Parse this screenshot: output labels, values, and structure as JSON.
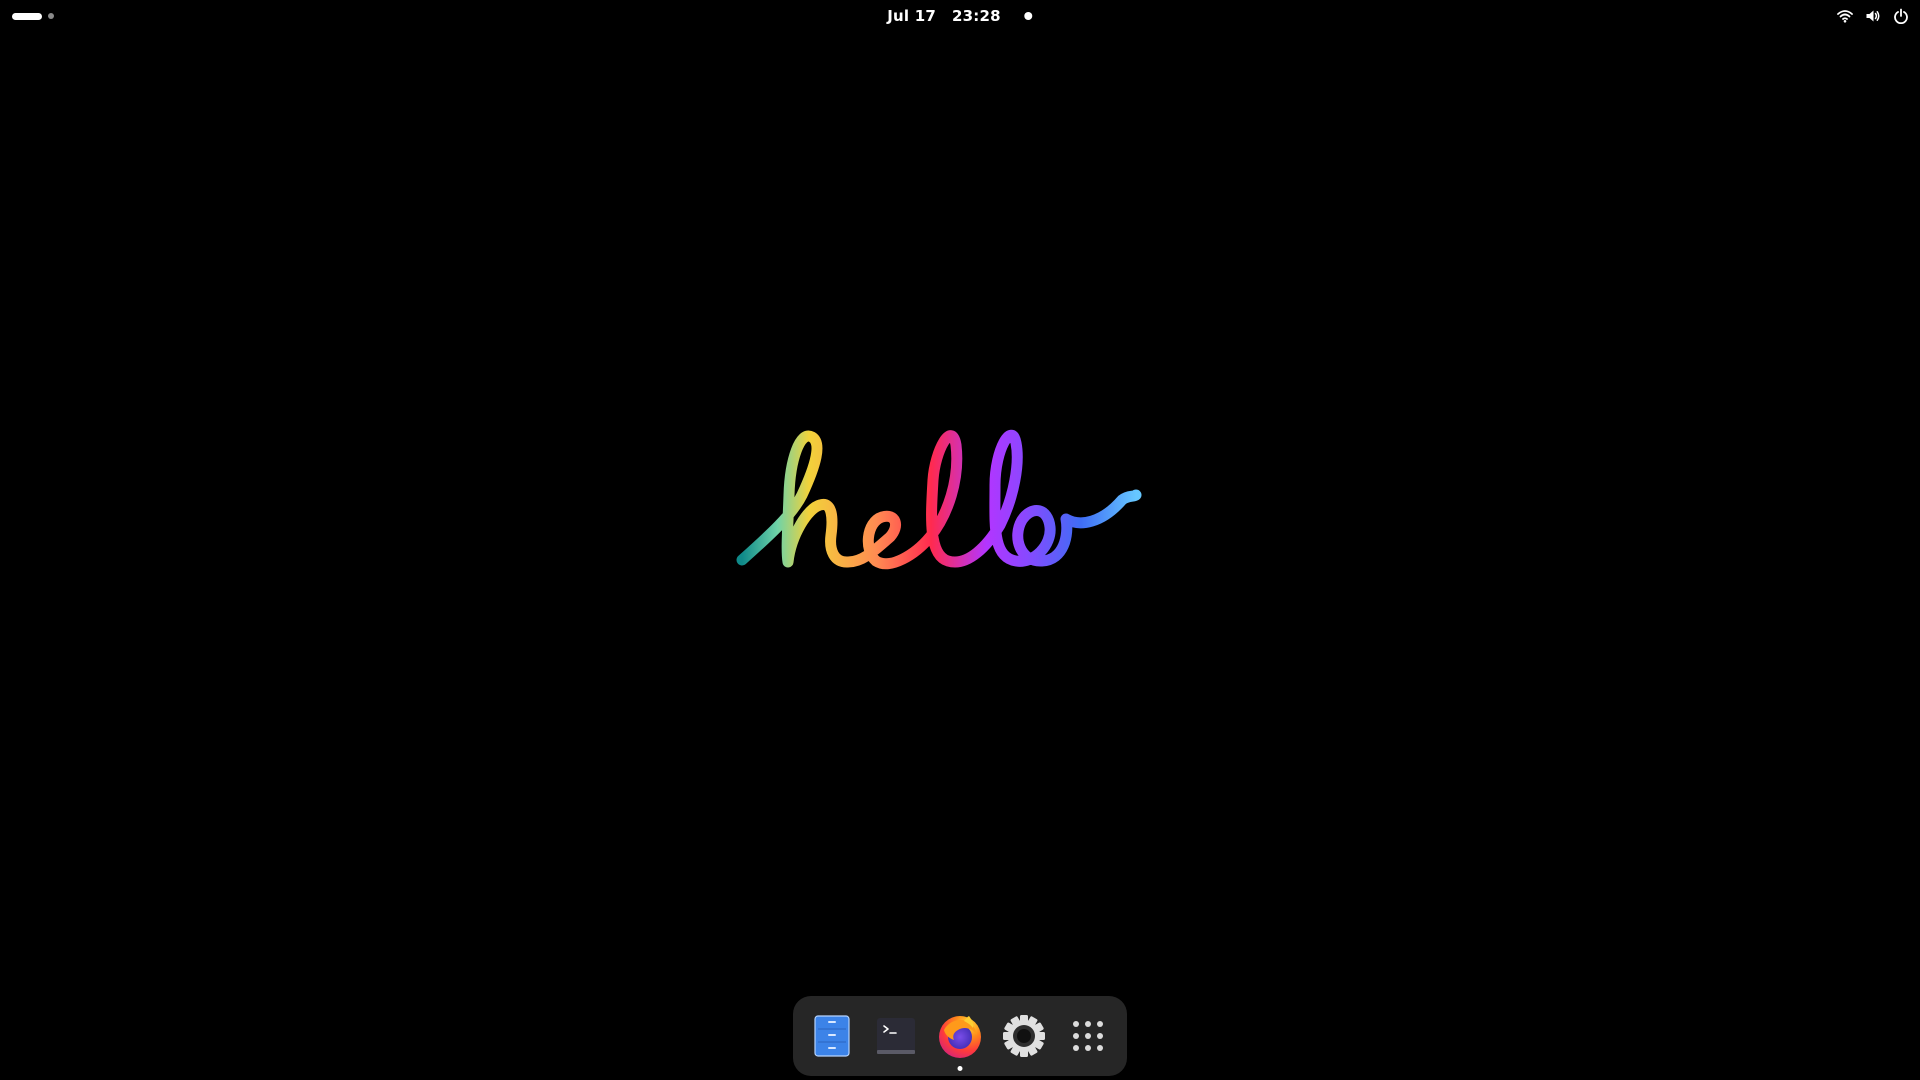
{
  "topbar": {
    "activities_icon": "workspace-indicator",
    "date": "Jul 17",
    "time": "23:28",
    "tray_icons": [
      "wifi-icon",
      "volume-icon",
      "power-icon"
    ]
  },
  "wallpaper": {
    "text": "hello",
    "colors": [
      "#0f8a8a",
      "#6fd3a8",
      "#f2d23a",
      "#ff8c52",
      "#ff2a4f",
      "#b335ff",
      "#8a48ff",
      "#3f6df5",
      "#66c7ff"
    ]
  },
  "dock": {
    "items": [
      {
        "name": "files",
        "icon": "file-cabinet-icon",
        "running": false
      },
      {
        "name": "terminal",
        "icon": "terminal-icon",
        "running": false
      },
      {
        "name": "firefox",
        "icon": "firefox-icon",
        "running": true
      },
      {
        "name": "settings",
        "icon": "gear-icon",
        "running": false
      },
      {
        "name": "show-applications",
        "icon": "app-grid-icon",
        "running": false
      }
    ]
  }
}
